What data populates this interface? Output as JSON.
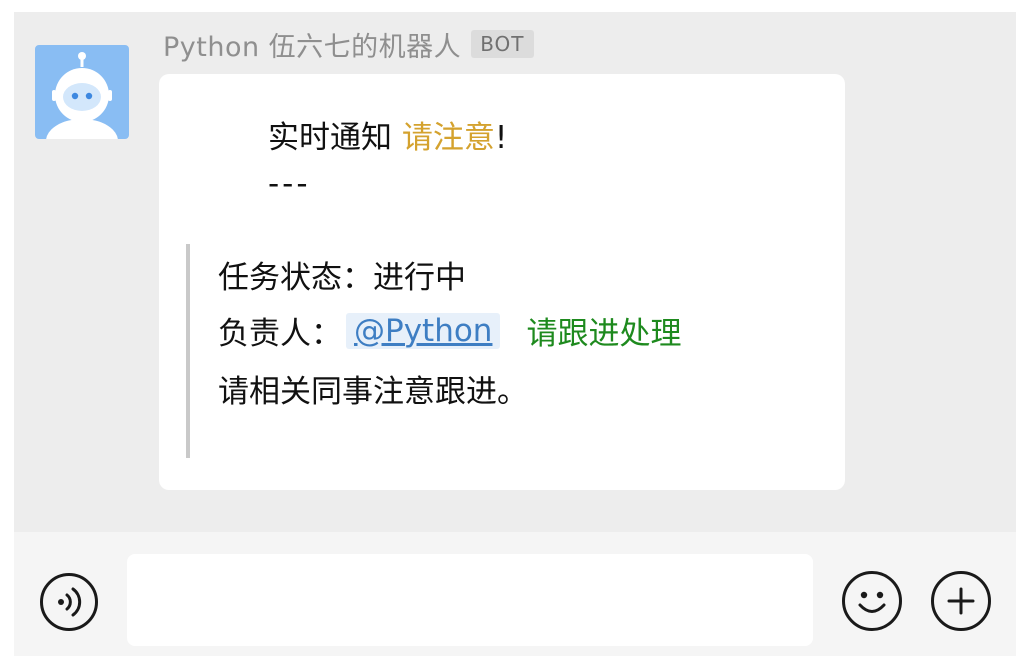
{
  "sender": {
    "name": "Python 伍六七的机器人",
    "badge": "BOT"
  },
  "message": {
    "title_prefix": "实时通知 ",
    "title_highlight": "请注意",
    "title_suffix": "!",
    "divider": "---",
    "quote": {
      "line1": "任务状态：进行中",
      "line2_label": "负责人：",
      "mention": "@Python",
      "follow_up": "请跟进处理",
      "line3": "请相关同事注意跟进。"
    }
  },
  "input_bar": {
    "placeholder": "",
    "voice_icon": "voice-icon",
    "emoji_icon": "emoji-icon",
    "plus_icon": "plus-icon"
  },
  "colors": {
    "highlight": "#d4a22e",
    "mention": "#3e7ec3",
    "follow_up": "#1e8a1e",
    "avatar_bg": "#89bdf3"
  }
}
